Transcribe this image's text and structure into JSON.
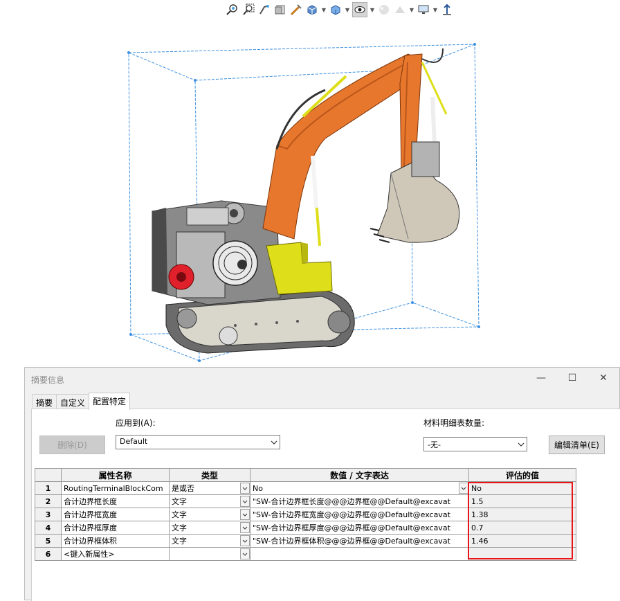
{
  "toolbar": {
    "icons": [
      "zoom-to-fit-icon",
      "zoom-area-icon",
      "previous-view-icon",
      "section-view-icon",
      "dynamic-annotation-icon",
      "view-orientation-icon",
      "display-style-icon",
      "hide-show-items-icon",
      "edit-appearance-icon",
      "apply-scene-icon",
      "view-settings-icon",
      "rotate-view-icon"
    ]
  },
  "dialog": {
    "title": "摘要信息",
    "minimize": "—",
    "maximize": "☐",
    "close": "✕",
    "tabs": [
      "摘要",
      "自定义",
      "配置特定"
    ],
    "active_tab": "配置特定",
    "apply_to_label": "应用到(A):",
    "apply_to_value": "Default",
    "bom_qty_label": "材料明细表数量:",
    "bom_qty_value": "-无-",
    "delete_button": "删除(D)",
    "edit_list_button": "编辑清单(E)"
  },
  "grid": {
    "headers": [
      "属性名称",
      "类型",
      "数值 / 文字表达",
      "评估的值"
    ],
    "rows": [
      {
        "num": "1",
        "name": "RoutingTerminalBlockCom",
        "type": "是或否",
        "value": "No",
        "evaluated": "No"
      },
      {
        "num": "2",
        "name": "合计边界框长度",
        "type": "文字",
        "value": "\"SW-合计边界框长度@@@边界框@@Default@excavat",
        "evaluated": "1.5"
      },
      {
        "num": "3",
        "name": "合计边界框宽度",
        "type": "文字",
        "value": "\"SW-合计边界框宽度@@@边界框@@Default@excavat",
        "evaluated": "1.38"
      },
      {
        "num": "4",
        "name": "合计边界框厚度",
        "type": "文字",
        "value": "\"SW-合计边界框厚度@@@边界框@@Default@excavat",
        "evaluated": "0.7"
      },
      {
        "num": "5",
        "name": "合计边界框体积",
        "type": "文字",
        "value": "\"SW-合计边界框体积@@@边界框@@Default@excavat",
        "evaluated": "1.46"
      },
      {
        "num": "6",
        "name": "<键入新属性>",
        "type": "",
        "value": "",
        "evaluated": ""
      }
    ]
  },
  "colors": {
    "boom": "#e8772e",
    "cab": "#dede1a",
    "highlight": "#e8161b",
    "bbox": "#3b8fe0"
  }
}
